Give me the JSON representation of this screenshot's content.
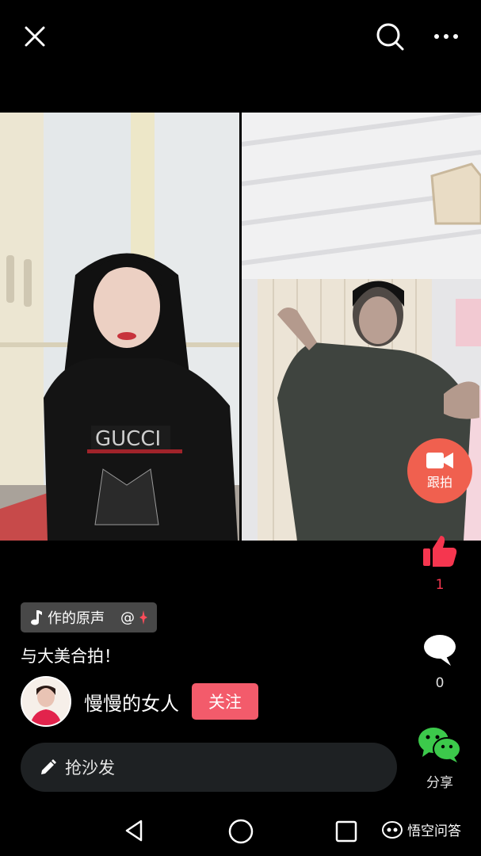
{
  "toolbar": {
    "close_icon": "close-icon",
    "search_icon": "search-icon",
    "more_icon": "more-icon"
  },
  "video": {
    "left_panel": "duet-video-left",
    "right_panel": "duet-video-right",
    "follow_shoot_label": "跟拍"
  },
  "actions": {
    "like_count": "1",
    "comment_count": "0",
    "share_label": "分享"
  },
  "post": {
    "music_label": "作的原声",
    "mention": "@",
    "caption": "与大美合拍！",
    "author_name": "慢慢的女人",
    "follow_label": "关注",
    "comment_placeholder": "抢沙发"
  },
  "watermark": {
    "text": "悟空问答"
  },
  "colors": {
    "accent_red": "#f35b6b",
    "like_red": "#f5364f",
    "follow_shoot": "#f0604f",
    "share_green": "#3cc94b"
  }
}
